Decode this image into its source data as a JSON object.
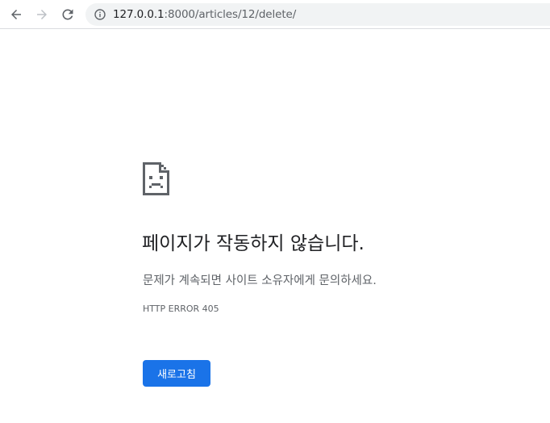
{
  "browser": {
    "address_bar": {
      "url_host": "127.0.0.1",
      "url_rest": ":8000/articles/12/delete/",
      "icon": "info-icon"
    },
    "nav_icons": [
      "back-arrow-icon",
      "forward-arrow-icon",
      "reload-icon"
    ]
  },
  "error_page": {
    "icon": "sad-document-icon",
    "heading": "페이지가 작동하지 않습니다.",
    "summary": "문제가 계속되면 사이트 소유자에게 문의하세요.",
    "error_code": "HTTP ERROR 405",
    "reload_button_label": "새로고침"
  },
  "colors": {
    "accent": "#1a73e8",
    "text_primary": "#202124",
    "text_secondary": "#5f6368",
    "omnibox_bg": "#f1f3f4"
  }
}
